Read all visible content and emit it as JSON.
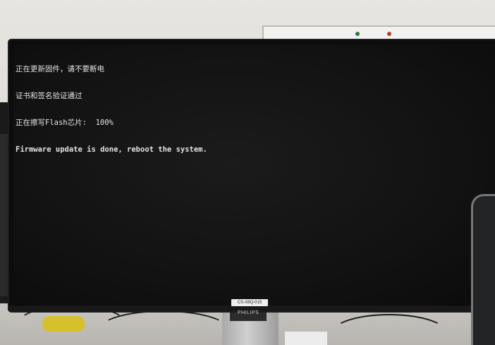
{
  "console": {
    "lines": [
      "正在更新固件，请不要断电",
      "证书和签名验证通过",
      "正在擦写Flash芯片:  100%",
      "Firmware update is done, reboot the system."
    ]
  },
  "monitor": {
    "sticker_text": "CS-X8Q-015",
    "brand_text": "PHILIPS"
  },
  "colors": {
    "screen_background": "#121212",
    "console_text": "#e4e4e4",
    "bezel": "#0c0c0c"
  }
}
